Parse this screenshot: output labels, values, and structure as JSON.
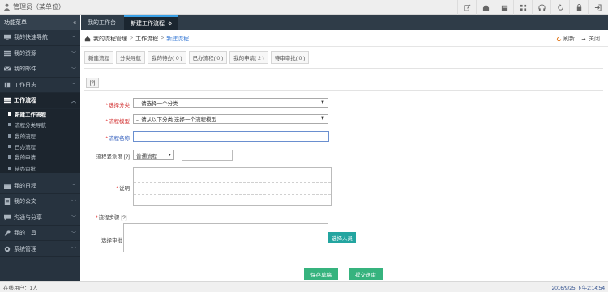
{
  "topbar": {
    "user": "管理员（某单位）",
    "tools": [
      "edit-icon",
      "home-icon",
      "folder-icon",
      "grid-icon",
      "headset-icon",
      "refresh-icon",
      "lock-icon",
      "exit-icon"
    ]
  },
  "sidebar": {
    "title": "功能菜单",
    "collapse": "«",
    "items_top": [
      {
        "label": "我的快速导航",
        "icon": "monitor-icon"
      },
      {
        "label": "我的资源",
        "icon": "list-icon"
      },
      {
        "label": "我的邮件",
        "icon": "mail-icon"
      },
      {
        "label": "工作日志",
        "icon": "book-icon"
      }
    ],
    "active": {
      "label": "工作流程",
      "icon": "workflow-icon"
    },
    "sub": [
      "新建工作流程",
      "流程分类导航",
      "我的流程",
      "已办流程",
      "我的申请",
      "待办审批"
    ],
    "items_bottom": [
      {
        "label": "我的日程",
        "icon": "calendar-icon"
      },
      {
        "label": "我的公文",
        "icon": "doc-icon"
      },
      {
        "label": "沟通与分享",
        "icon": "chat-icon"
      },
      {
        "label": "我的工具",
        "icon": "tools-icon"
      },
      {
        "label": "系统管理",
        "icon": "settings-icon"
      }
    ]
  },
  "tabs": [
    {
      "label": "我的工作台"
    },
    {
      "label": "新建工作流程",
      "close": "⚙"
    }
  ],
  "breadcrumb": {
    "home": "我的流程管理",
    "mid": "工作流程",
    "current": "新建流程",
    "refresh": "刷新",
    "close": "关闭"
  },
  "toolbar": [
    "新建流程",
    "分类导航",
    "我的待办( 0 )",
    "已办流程( 0 )",
    "我的申请( 2 )",
    "待审审批( 0 )"
  ],
  "form": {
    "tab": "[?]",
    "category_label": "选择分类",
    "category_value": "-- 请选择一个分类",
    "model_label": "流程模型",
    "model_value": "-- 请从以下分类 选择一个流程模型",
    "name_label": "流程名称",
    "priority_label": "流程紧急度 [?]",
    "priority_value": "普通流程",
    "desc_label": "说明",
    "steps_label": "流程步骤 [?]",
    "approver_label": "选择审批 [?]",
    "select_button": "选择人员",
    "save_button": "保存草稿",
    "submit_button": "提交送审"
  },
  "status": {
    "online": "在线用户：1人",
    "datetime": "2016/9/25 下午2:14:54"
  },
  "colors": {
    "sidebar": "#27333f",
    "accent_green": "#36b37e",
    "required_red": "#e02020"
  }
}
